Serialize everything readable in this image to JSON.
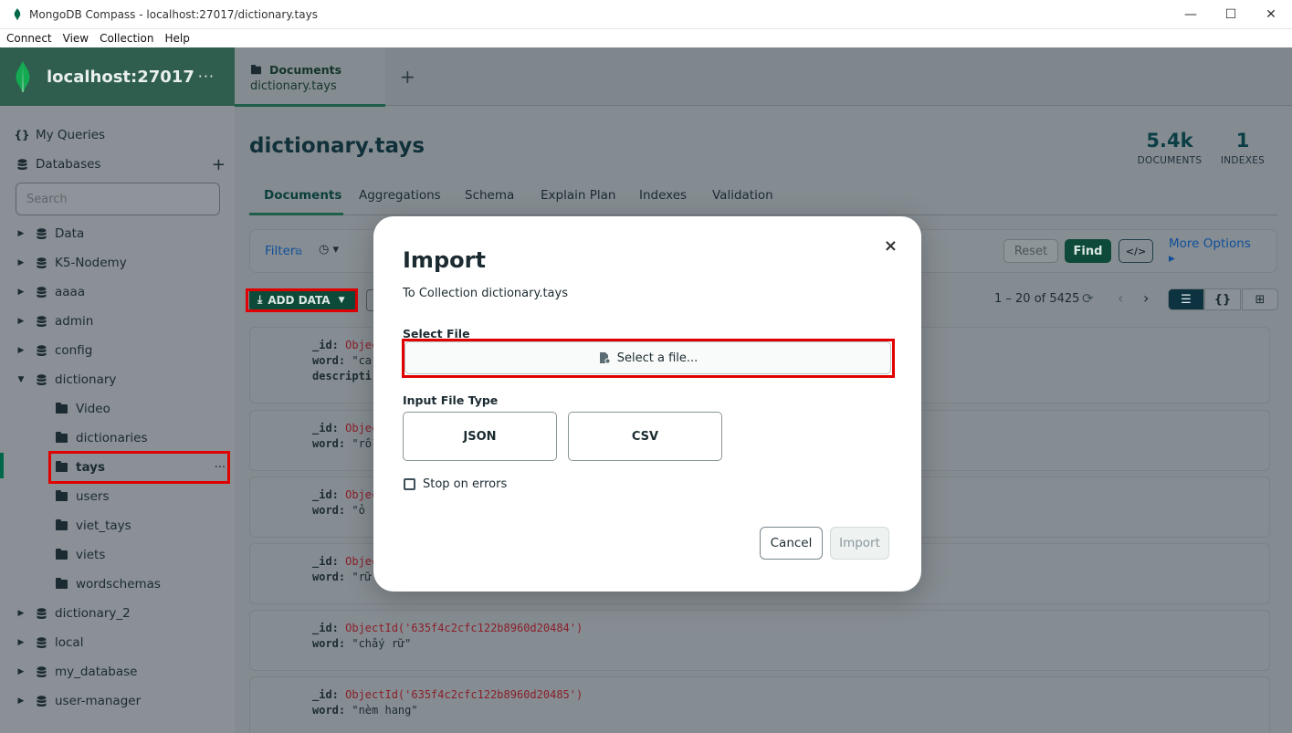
{
  "window": {
    "title": "MongoDB Compass - localhost:27017/dictionary.tays",
    "minimize": "—",
    "maximize": "☐",
    "close": "✕"
  },
  "menu": [
    "Connect",
    "View",
    "Collection",
    "Help"
  ],
  "sidebar": {
    "connection_name": "localhost:27017",
    "connection_menu": "···",
    "my_queries": "My Queries",
    "databases": "Databases",
    "add_database": "+",
    "search_placeholder": "Search",
    "databases_list": [
      {
        "name": "Data",
        "expanded": false
      },
      {
        "name": "K5-Nodemy",
        "expanded": false
      },
      {
        "name": "aaaa",
        "expanded": false
      },
      {
        "name": "admin",
        "expanded": false
      },
      {
        "name": "config",
        "expanded": false
      },
      {
        "name": "dictionary",
        "expanded": true
      },
      {
        "name": "dictionary_2",
        "expanded": false
      },
      {
        "name": "local",
        "expanded": false
      },
      {
        "name": "my_database",
        "expanded": false
      },
      {
        "name": "user-manager",
        "expanded": false
      }
    ],
    "collections": [
      "Video",
      "dictionaries",
      "tays",
      "users",
      "viet_tays",
      "viets",
      "wordschemas"
    ],
    "selected_collection": "tays",
    "selected_menu": "···"
  },
  "tabs": {
    "active_type": "Documents",
    "active_name": "dictionary.tays",
    "add": "+"
  },
  "collection": {
    "title": "dictionary.tays",
    "documents_count": "5.4k",
    "documents_label": "DOCUMENTS",
    "indexes_count": "1",
    "indexes_label": "INDEXES"
  },
  "subtabs": [
    "Documents",
    "Aggregations",
    "Schema",
    "Explain Plan",
    "Indexes",
    "Validation"
  ],
  "querybar": {
    "filter": "Filter",
    "reset": "Reset",
    "find": "Find",
    "code": "</>",
    "more_options": "More Options ▸"
  },
  "toolbar": {
    "add_data": "ADD DATA",
    "pagination": "1 – 20 of 5425"
  },
  "documents": [
    {
      "id_prefix": "ObjectId('635f4c2cfc122b8960d2048",
      "lines": [
        [
          "_id: ",
          "Objec"
        ],
        [
          "word: ",
          "\"ca"
        ],
        [
          "descripti",
          ""
        ]
      ]
    },
    {
      "lines": [
        [
          "_id: ",
          "Objec"
        ],
        [
          "word: ",
          "\"rỗ"
        ]
      ]
    },
    {
      "lines": [
        [
          "_id: ",
          "Objec"
        ],
        [
          "word: ",
          "\"ỏ"
        ]
      ]
    },
    {
      "lines": [
        [
          "_id: ",
          "Objec"
        ],
        [
          "word: ",
          "\"rữ"
        ]
      ]
    },
    {
      "lines": [
        [
          "_id: ",
          "ObjectId('635f4c2cfc122b8960d20484')"
        ],
        [
          "word: ",
          "\"chấy rữ\""
        ]
      ]
    },
    {
      "lines": [
        [
          "_id: ",
          "ObjectId('635f4c2cfc122b8960d20485')"
        ],
        [
          "word: ",
          "\"nèm hang\""
        ]
      ]
    }
  ],
  "modal": {
    "title": "Import",
    "subtitle": "To Collection dictionary.tays",
    "select_file_label": "Select File",
    "select_file_button": "Select a file...",
    "input_type_label": "Input File Type",
    "json": "JSON",
    "csv": "CSV",
    "stop_on_errors": "Stop on errors",
    "cancel": "Cancel",
    "import": "Import",
    "close": "×"
  },
  "colors": {
    "brand_green": "#00684a",
    "highlight_red": "#e00000"
  }
}
